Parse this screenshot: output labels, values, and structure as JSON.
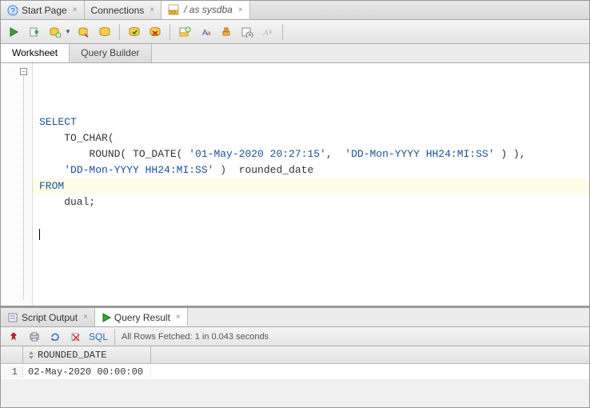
{
  "top_tabs": {
    "start": "Start Page",
    "connections": "Connections",
    "session": "/ as sysdba"
  },
  "ws_tabs": {
    "worksheet": "Worksheet",
    "builder": "Query Builder"
  },
  "sql": {
    "l1_kw": "SELECT",
    "l2": "    TO_CHAR(",
    "l3a": "        ROUND( TO_DATE( ",
    "l3s1": "'01-May-2020 20:27:15'",
    "l3b": ",  ",
    "l3s2": "'DD-Mon-YYYY HH24:MI:SS'",
    "l3c": " ) ),",
    "l4a": "    ",
    "l4s": "'DD-Mon-YYYY HH24:MI:SS'",
    "l4b": " )  rounded_date",
    "l5_kw": "FROM",
    "l6": "    dual;"
  },
  "out_tabs": {
    "script": "Script Output",
    "query": "Query Result"
  },
  "out_toolbar": {
    "sql_label": "SQL",
    "status": "All Rows Fetched: 1 in 0.043 seconds"
  },
  "grid": {
    "col1": "ROUNDED_DATE",
    "row1_num": "1",
    "row1_val": "02-May-2020 00:00:00"
  }
}
